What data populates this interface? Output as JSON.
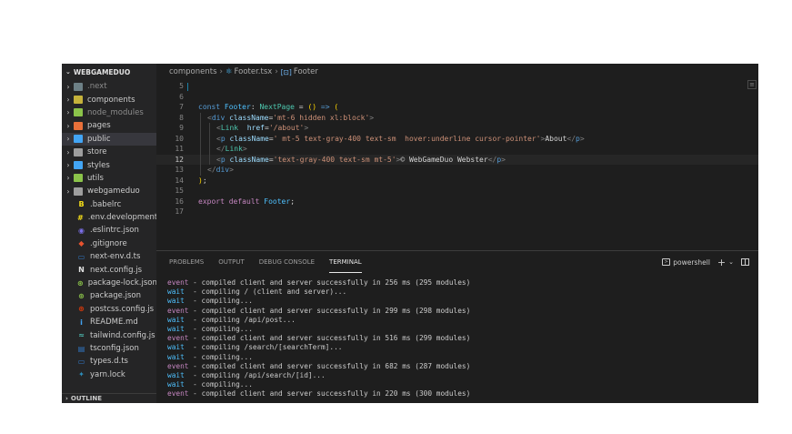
{
  "explorer": {
    "title": "WEBGAMEDUO",
    "outline_label": "OUTLINE",
    "items": [
      {
        "label": "next",
        "kind": "folder",
        "color": "#6d8086",
        "dim": true,
        "prefix": "."
      },
      {
        "label": "components",
        "kind": "folder",
        "color": "#c5b23b",
        "dim": false,
        "prefix": ""
      },
      {
        "label": "node_modules",
        "kind": "folder",
        "color": "#8bc34a",
        "dim": true,
        "prefix": ""
      },
      {
        "label": "pages",
        "kind": "folder",
        "color": "#e8703a",
        "dim": false,
        "prefix": ""
      },
      {
        "label": "public",
        "kind": "folder",
        "color": "#42a5f5",
        "dim": false,
        "prefix": "",
        "selected": true
      },
      {
        "label": "store",
        "kind": "folder",
        "color": "#9e9e9e",
        "dim": false,
        "prefix": ""
      },
      {
        "label": "styles",
        "kind": "folder",
        "color": "#42a5f5",
        "dim": false,
        "prefix": ""
      },
      {
        "label": "utils",
        "kind": "folder",
        "color": "#8bc34a",
        "dim": false,
        "prefix": ""
      },
      {
        "label": "webgameduo",
        "kind": "folder",
        "color": "#9e9e9e",
        "dim": false,
        "prefix": ""
      },
      {
        "label": ".babelrc",
        "kind": "file",
        "icon": "B",
        "color": "#f5de19"
      },
      {
        "label": ".env.development",
        "kind": "file",
        "icon": "#",
        "color": "#f5de19"
      },
      {
        "label": ".eslintrc.json",
        "kind": "file",
        "icon": "◉",
        "color": "#7b6fe8"
      },
      {
        "label": ".gitignore",
        "kind": "file",
        "icon": "◆",
        "color": "#e8532f"
      },
      {
        "label": "next-env.d.ts",
        "kind": "file",
        "icon": "▭",
        "color": "#3178c6"
      },
      {
        "label": "next.config.js",
        "kind": "file",
        "icon": "N",
        "color": "#e0e0e0"
      },
      {
        "label": "package-lock.json",
        "kind": "file",
        "icon": "⊛",
        "color": "#8bc34a"
      },
      {
        "label": "package.json",
        "kind": "file",
        "icon": "⊛",
        "color": "#8bc34a"
      },
      {
        "label": "postcss.config.js",
        "kind": "file",
        "icon": "⊛",
        "color": "#dd3a0a"
      },
      {
        "label": "README.md",
        "kind": "file",
        "icon": "i",
        "color": "#42a5f5"
      },
      {
        "label": "tailwind.config.js",
        "kind": "file",
        "icon": "≈",
        "color": "#4db6ac"
      },
      {
        "label": "tsconfig.json",
        "kind": "file",
        "icon": "▤",
        "color": "#3178c6"
      },
      {
        "label": "types.d.ts",
        "kind": "file",
        "icon": "▭",
        "color": "#3178c6"
      },
      {
        "label": "yarn.lock",
        "kind": "file",
        "icon": "✦",
        "color": "#2c8ebb"
      }
    ]
  },
  "breadcrumb": {
    "folder": "components",
    "file": "Footer.tsx",
    "symbol": "Footer"
  },
  "editor": {
    "current_line": 12,
    "lines": [
      {
        "n": "5",
        "indent": 0,
        "tokens": []
      },
      {
        "n": "6",
        "indent": 0,
        "tokens": []
      },
      {
        "n": "7",
        "indent": 0,
        "tokens": [
          [
            "kw",
            "const "
          ],
          [
            "var",
            "Footer"
          ],
          [
            "txt",
            ": "
          ],
          [
            "type",
            "NextPage"
          ],
          [
            "txt",
            " = "
          ],
          [
            "br1",
            "("
          ],
          [
            "br1",
            ")"
          ],
          [
            "kw",
            " =>"
          ],
          [
            "txt",
            " "
          ],
          [
            "br1",
            "("
          ]
        ]
      },
      {
        "n": "8",
        "indent": 1,
        "tokens": [
          [
            "punc",
            "<"
          ],
          [
            "tag",
            "div"
          ],
          [
            "txt",
            " "
          ],
          [
            "attr",
            "className"
          ],
          [
            "txt",
            "="
          ],
          [
            "str",
            "'mt-6 hidden xl:block'"
          ],
          [
            "punc",
            ">"
          ]
        ]
      },
      {
        "n": "9",
        "indent": 2,
        "tokens": [
          [
            "punc",
            "<"
          ],
          [
            "comp",
            "Link"
          ],
          [
            "txt",
            "  "
          ],
          [
            "attr",
            "href"
          ],
          [
            "txt",
            "="
          ],
          [
            "str",
            "'/about'"
          ],
          [
            "punc",
            ">"
          ]
        ]
      },
      {
        "n": "10",
        "indent": 2,
        "tokens": [
          [
            "punc",
            "<"
          ],
          [
            "tag",
            "p"
          ],
          [
            "txt",
            " "
          ],
          [
            "attr",
            "className"
          ],
          [
            "txt",
            "="
          ],
          [
            "str",
            "' mt-5 text-gray-400 text-sm  hover:underline cursor-pointer'"
          ],
          [
            "punc",
            ">"
          ],
          [
            "txt",
            "About"
          ],
          [
            "punc",
            "</"
          ],
          [
            "tag",
            "p"
          ],
          [
            "punc",
            ">"
          ]
        ]
      },
      {
        "n": "11",
        "indent": 2,
        "tokens": [
          [
            "punc",
            "</"
          ],
          [
            "comp",
            "Link"
          ],
          [
            "punc",
            ">"
          ]
        ]
      },
      {
        "n": "12",
        "indent": 2,
        "tokens": [
          [
            "punc",
            "<"
          ],
          [
            "tag",
            "p"
          ],
          [
            "txt",
            " "
          ],
          [
            "attr",
            "className"
          ],
          [
            "txt",
            "="
          ],
          [
            "str",
            "'text-gray-400 text-sm mt-5'"
          ],
          [
            "punc",
            ">"
          ],
          [
            "txt",
            "© WebGameDuo Webster"
          ],
          [
            "punc",
            "</"
          ],
          [
            "tag",
            "p"
          ],
          [
            "punc",
            ">"
          ]
        ]
      },
      {
        "n": "13",
        "indent": 1,
        "tokens": [
          [
            "punc",
            "</"
          ],
          [
            "tag",
            "div"
          ],
          [
            "punc",
            ">"
          ]
        ]
      },
      {
        "n": "14",
        "indent": 0,
        "tokens": [
          [
            "br1",
            ")"
          ],
          [
            "txt",
            ";"
          ]
        ]
      },
      {
        "n": "15",
        "indent": 0,
        "tokens": []
      },
      {
        "n": "16",
        "indent": 0,
        "tokens": [
          [
            "ctl",
            "export"
          ],
          [
            "txt",
            " "
          ],
          [
            "ctl",
            "default"
          ],
          [
            "txt",
            " "
          ],
          [
            "var",
            "Footer"
          ],
          [
            "txt",
            ";"
          ]
        ]
      },
      {
        "n": "17",
        "indent": 0,
        "tokens": []
      }
    ]
  },
  "panel": {
    "tabs": [
      "PROBLEMS",
      "OUTPUT",
      "DEBUG CONSOLE",
      "TERMINAL"
    ],
    "active_tab": "TERMINAL",
    "shell_label": "powershell",
    "add_icon": "+",
    "dropdown_icon": "⌄"
  },
  "terminal": {
    "lines": [
      {
        "tag": "event",
        "text": " - compiled client and server successfully in 256 ms (295 modules)"
      },
      {
        "tag": "wait",
        "text": "  - compiling / (client and server)..."
      },
      {
        "tag": "wait",
        "text": "  - compiling..."
      },
      {
        "tag": "event",
        "text": " - compiled client and server successfully in 299 ms (298 modules)"
      },
      {
        "tag": "wait",
        "text": "  - compiling /api/post..."
      },
      {
        "tag": "wait",
        "text": "  - compiling..."
      },
      {
        "tag": "event",
        "text": " - compiled client and server successfully in 516 ms (299 modules)"
      },
      {
        "tag": "wait",
        "text": "  - compiling /search/[searchTerm]..."
      },
      {
        "tag": "wait",
        "text": "  - compiling..."
      },
      {
        "tag": "event",
        "text": " - compiled client and server successfully in 682 ms (287 modules)"
      },
      {
        "tag": "wait",
        "text": "  - compiling /api/search/[id]..."
      },
      {
        "tag": "wait",
        "text": "  - compiling..."
      },
      {
        "tag": "event",
        "text": " - compiled client and server successfully in 220 ms (300 modules)"
      }
    ]
  }
}
